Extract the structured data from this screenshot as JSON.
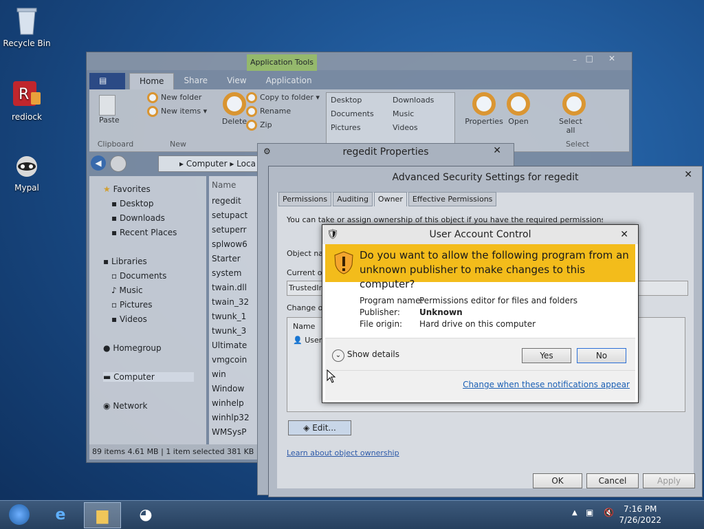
{
  "desktop": {
    "icons": [
      {
        "label": "Recycle Bin",
        "icon": "recycle-bin-icon"
      },
      {
        "label": "rediock",
        "icon": "app-icon"
      },
      {
        "label": "Mypal",
        "icon": "raccoon-icon"
      }
    ]
  },
  "explorer": {
    "ribbon_tabs": [
      "Home",
      "Share",
      "View",
      "Application"
    ],
    "app_tools": "Application Tools",
    "clipboard": {
      "paste": "Paste",
      "group": "Clipboard"
    },
    "new_group": {
      "new_folder": "New folder",
      "new_items": "New items",
      "group": "New"
    },
    "organize": {
      "delete": "Delete",
      "copy_to": "Copy to folder",
      "rename": "Rename",
      "zip": "Zip"
    },
    "places": [
      "Desktop",
      "Documents",
      "Pictures",
      "Downloads",
      "Music",
      "Videos"
    ],
    "open_group": {
      "properties": "Properties",
      "open": "Open"
    },
    "select_group": {
      "select_all": "Select all",
      "group": "Select"
    },
    "address": [
      "Computer",
      "Loca"
    ],
    "nav": {
      "favorites": "Favorites",
      "desktop": "Desktop",
      "downloads": "Downloads",
      "recent": "Recent Places",
      "libraries": "Libraries",
      "documents": "Documents",
      "music": "Music",
      "pictures": "Pictures",
      "videos": "Videos",
      "homegroup": "Homegroup",
      "computer": "Computer",
      "network": "Network"
    },
    "name_header": "Name",
    "files": [
      "regedit",
      "setupact",
      "setuperr",
      "splwow6",
      "Starter",
      "system",
      "twain.dll",
      "twain_32",
      "twunk_1",
      "twunk_3",
      "Ultimate",
      "vmgcoin",
      "win",
      "Window",
      "winhelp",
      "winhlp32",
      "WMSysP"
    ],
    "status": {
      "items": "89 items",
      "size": "4.61 MB",
      "selected": "1 item selected",
      "sel_size": "381 KB"
    }
  },
  "props": {
    "title": "regedit Properties"
  },
  "advanced": {
    "title": "Advanced Security Settings for regedit",
    "tabs": [
      "Permissions",
      "Auditing",
      "Owner",
      "Effective Permissions"
    ],
    "info": "You can take or assign ownership of this object if you have the required permissions or privileges.",
    "object_name": "Object nam",
    "current_owner": "Current ow",
    "owner_value": "TrustedIns",
    "change_owner": "Change ow",
    "list_header": "Name",
    "list_item": "User",
    "edit": "Edit...",
    "learn": "Learn about object ownership",
    "ok": "OK",
    "cancel": "Cancel",
    "apply": "Apply"
  },
  "uac": {
    "title": "User Account Control",
    "question": "Do you want to allow the following program from an unknown publisher to make changes to this computer?",
    "program_label": "Program name:",
    "program_value": "Permissions editor for files and folders",
    "publisher_label": "Publisher:",
    "publisher_value": "Unknown",
    "origin_label": "File origin:",
    "origin_value": "Hard drive on this computer",
    "show_details": "Show details",
    "yes": "Yes",
    "no": "No",
    "change_link": "Change when these notifications appear"
  },
  "taskbar": {
    "time": "7:16 PM",
    "date": "7/26/2022"
  }
}
